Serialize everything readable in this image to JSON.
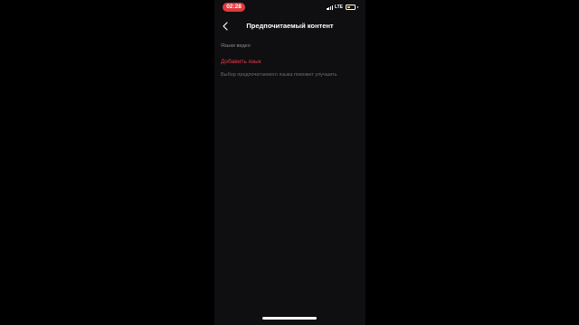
{
  "status_bar": {
    "time": "02:28",
    "network": "LTE",
    "battery_level": 0.5,
    "time_pill_color": "#e0393e",
    "battery_color": "#ffd60a"
  },
  "nav": {
    "title": "Предпочитаемый контент"
  },
  "content": {
    "section_label": "Языки видео",
    "add_language": "Добавить язык",
    "hint": "Выбор предпочитаемого языка поможет улучшить"
  },
  "colors": {
    "background": "#0f0e10",
    "accent": "#e5394a"
  }
}
